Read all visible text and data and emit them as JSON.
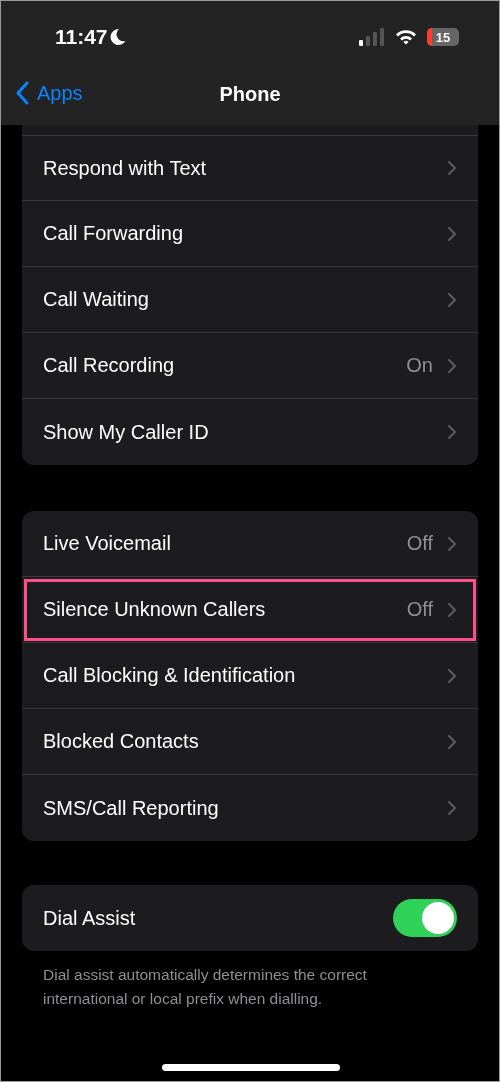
{
  "status_bar": {
    "time": "11:47",
    "battery": "15",
    "battery_low": true
  },
  "nav": {
    "back": "Apps",
    "title": "Phone"
  },
  "groups": [
    {
      "cut_top": true,
      "rows": [
        {
          "kind": "link",
          "label": "Respond with Text",
          "highlighted": false
        },
        {
          "kind": "link",
          "label": "Call Forwarding",
          "highlighted": false
        },
        {
          "kind": "link",
          "label": "Call Waiting",
          "highlighted": false
        },
        {
          "kind": "link",
          "label": "Call Recording",
          "value": "On",
          "highlighted": false
        },
        {
          "kind": "link",
          "label": "Show My Caller ID",
          "highlighted": false
        }
      ]
    },
    {
      "cut_top": false,
      "rows": [
        {
          "kind": "link",
          "label": "Live Voicemail",
          "value": "Off",
          "highlighted": false
        },
        {
          "kind": "link",
          "label": "Silence Unknown Callers",
          "value": "Off",
          "highlighted": true
        },
        {
          "kind": "link",
          "label": "Call Blocking & Identification",
          "highlighted": false
        },
        {
          "kind": "link",
          "label": "Blocked Contacts",
          "highlighted": false
        },
        {
          "kind": "link",
          "label": "SMS/Call Reporting",
          "highlighted": false
        }
      ]
    },
    {
      "cut_top": false,
      "rows": [
        {
          "kind": "toggle",
          "label": "Dial Assist",
          "on": true
        }
      ],
      "footer": "Dial assist automatically determines the correct international or local prefix when dialling."
    }
  ]
}
